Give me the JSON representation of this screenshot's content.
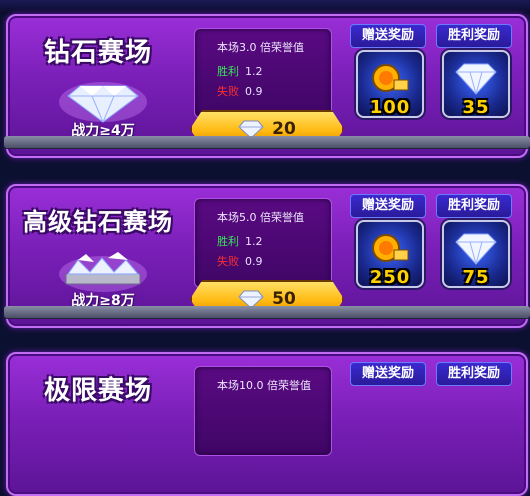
{
  "arenas": [
    {
      "title": "钻石赛场",
      "power": "战力≥4万",
      "honor_label": "本场3.0 倍荣誉值",
      "win_label": "胜利",
      "win_value": "1.2",
      "lose_label": "失败",
      "lose_value": "0.9",
      "entry_cost": "20",
      "gift_label": "赠送奖励",
      "victory_label": "胜利奖励",
      "gift_amount": "100",
      "victory_amount": "35"
    },
    {
      "title": "高级钻石赛场",
      "power": "战力≥8万",
      "honor_label": "本场5.0 倍荣誉值",
      "win_label": "胜利",
      "win_value": "1.2",
      "lose_label": "失败",
      "lose_value": "0.9",
      "entry_cost": "50",
      "gift_label": "赠送奖励",
      "victory_label": "胜利奖励",
      "gift_amount": "250",
      "victory_amount": "75"
    },
    {
      "title": "极限赛场",
      "honor_label": "本场10.0 倍荣誉值",
      "gift_label": "赠送奖励",
      "victory_label": "胜利奖励"
    }
  ],
  "colors": {
    "win": "#38e65a",
    "lose": "#ff3030",
    "amount": "#ffd000"
  },
  "icons": {
    "gift": "coin-stack-icon",
    "victory": "diamond-icon",
    "entry": "diamond-icon"
  }
}
